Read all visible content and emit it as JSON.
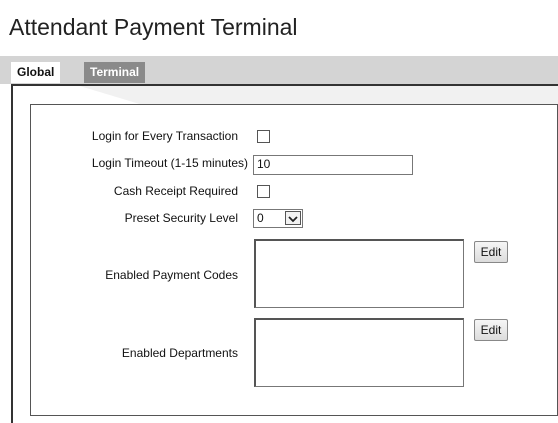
{
  "page": {
    "title": "Attendant Payment Terminal"
  },
  "tabs": [
    {
      "label": "Global",
      "active": true
    },
    {
      "label": "Terminal",
      "active": false
    }
  ],
  "form": {
    "login_every_transaction": {
      "label": "Login for Every Transaction",
      "checked": false
    },
    "login_timeout": {
      "label": "Login Timeout (1-15 minutes)",
      "value": "10"
    },
    "cash_receipt_required": {
      "label": "Cash Receipt Required",
      "checked": false
    },
    "preset_security_level": {
      "label": "Preset Security Level",
      "value": "0"
    },
    "enabled_payment_codes": {
      "label": "Enabled Payment Codes",
      "edit_label": "Edit"
    },
    "enabled_departments": {
      "label": "Enabled Departments",
      "edit_label": "Edit"
    }
  },
  "colors": {
    "active_tab": "#ffffff",
    "inactive_tab": "#8a8a8a",
    "tab_bar": "#d4d4d4"
  },
  "icons": {
    "select_toggle": "chevron-down-icon"
  }
}
